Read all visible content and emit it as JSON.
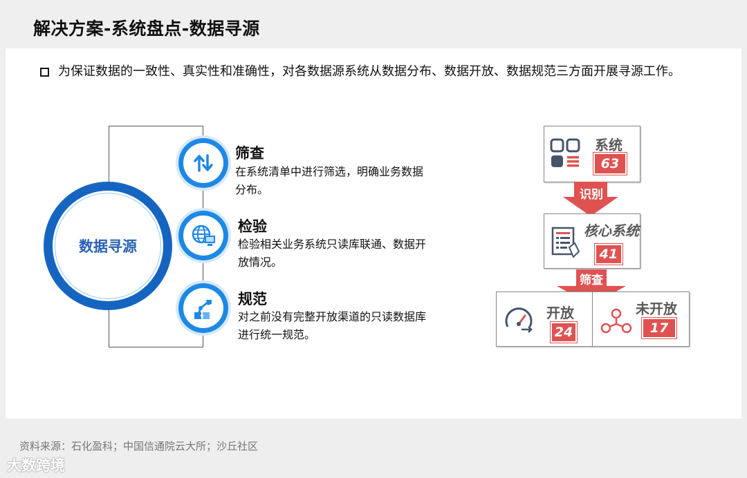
{
  "header": {
    "title": "解决方案-系统盘点-数据寻源"
  },
  "intro": {
    "text": "为保证数据的一致性、真实性和准确性，对各数据源系统从数据分布、数据开放、数据规范三方面开展寻源工作。"
  },
  "left": {
    "core_label": "数据寻源",
    "steps": [
      {
        "title": "筛查",
        "desc": "在系统清单中进行筛选，明确业务数据分布。",
        "icon": "sort-arrows-icon"
      },
      {
        "title": "检验",
        "desc": "检验相关业务系统只读库联通、数据开放情况。",
        "icon": "globe-computer-icon"
      },
      {
        "title": "规范",
        "desc": "对之前没有完整开放渠道的只读数据库进行统一规范。",
        "icon": "robot-arm-puzzle-icon"
      }
    ]
  },
  "right": {
    "system": {
      "label": "系统",
      "count": "63"
    },
    "arrow1": "识别",
    "core_system": {
      "label": "核心系统",
      "count": "41"
    },
    "arrow2": "筛查",
    "open": {
      "label": "开放",
      "count": "24"
    },
    "closed": {
      "label": "未开放",
      "count": "17"
    }
  },
  "footer": {
    "source": "资料来源：石化盈科；中国信通院云大所；沙丘社区",
    "watermark": "大数跨境"
  },
  "colors": {
    "primary_blue": "#1565c0",
    "accent_red": "#e05252",
    "label_gray": "#595959"
  }
}
